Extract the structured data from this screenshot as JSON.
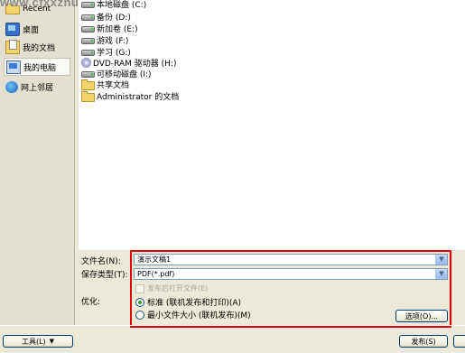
{
  "watermark": "www.cfxxzhu",
  "places": [
    {
      "label": "Recent",
      "icon": "recent-folder-icon"
    },
    {
      "label": "桌面",
      "icon": "desktop-icon"
    },
    {
      "label": "我的文档",
      "icon": "my-documents-icon"
    },
    {
      "label": "我的电脑",
      "icon": "my-computer-icon",
      "active": true
    },
    {
      "label": "网上邻居",
      "icon": "network-places-icon"
    }
  ],
  "files": [
    {
      "label": "本地磁盘 (C:)",
      "icon": "hard-drive-icon"
    },
    {
      "label": "备份 (D:)",
      "icon": "hard-drive-icon"
    },
    {
      "label": "新加卷 (E:)",
      "icon": "hard-drive-icon"
    },
    {
      "label": "游戏 (F:)",
      "icon": "hard-drive-icon"
    },
    {
      "label": "学习 (G:)",
      "icon": "hard-drive-icon"
    },
    {
      "label": "DVD-RAM 驱动器 (H:)",
      "icon": "dvd-drive-icon"
    },
    {
      "label": "可移动磁盘 (I:)",
      "icon": "removable-disk-icon"
    },
    {
      "label": "共享文档",
      "icon": "folder-icon"
    },
    {
      "label": "Administrator 的文档",
      "icon": "folder-icon"
    }
  ],
  "form": {
    "filename_label": "文件名(N):",
    "filename_value": "演示文稿1",
    "filetype_label": "保存类型(T):",
    "filetype_value": "PDF(*.pdf)",
    "open_after_label": "发布后打开文件(E)",
    "optimize_label": "优化:",
    "option_standard": "标准 (联机发布和打印)(A)",
    "option_min": "最小文件大小 (联机发布)(M)",
    "options_button": "选项(O)..."
  },
  "bottom": {
    "tools_button": "工具(L)",
    "publish_button": "发布(S)"
  }
}
